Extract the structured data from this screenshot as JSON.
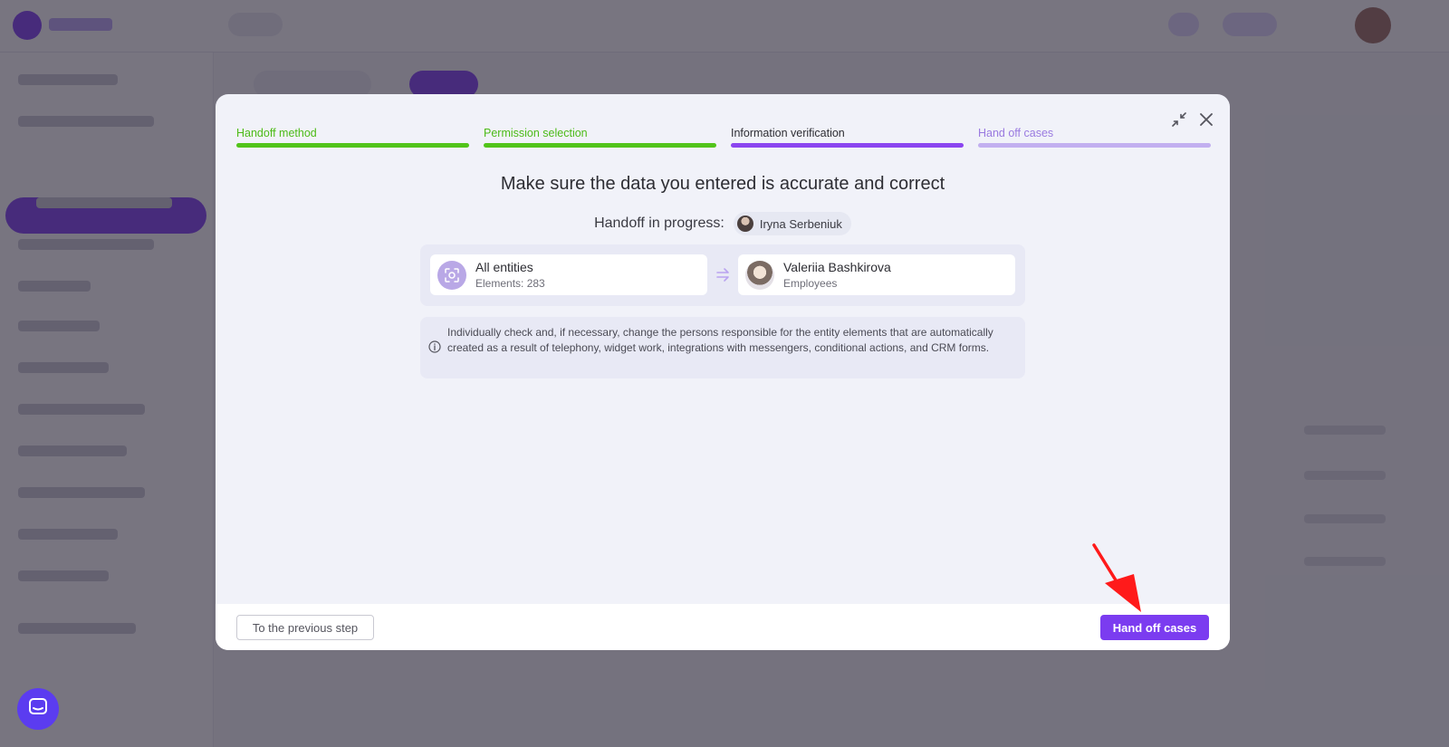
{
  "modal": {
    "steps": [
      {
        "label": "Handoff method",
        "status": "completed",
        "label_color": "#4cbb17",
        "bar_color": "#52c41a"
      },
      {
        "label": "Permission selection",
        "status": "completed",
        "label_color": "#4cbb17",
        "bar_color": "#52c41a"
      },
      {
        "label": "Information verification",
        "status": "current",
        "label_color": "#2d2d33",
        "bar_color": "#8b45f0"
      },
      {
        "label": "Hand off cases",
        "status": "upcoming",
        "label_color": "#9a7ae0",
        "bar_color": "#c2aff0"
      }
    ],
    "headline": "Make sure the data you entered is accurate and correct",
    "handoff": {
      "label": "Handoff in progress:",
      "user_name": "Iryna Serbeniuk"
    },
    "transfer": {
      "from": {
        "title": "All entities",
        "subtitle": "Elements: 283",
        "icon": "scan-icon"
      },
      "arrow_icon": "arrow-right-icon",
      "to": {
        "title": "Valeriia Bashkirova",
        "subtitle": "Employees"
      }
    },
    "info_text": "Individually check and, if necessary, change the persons responsible for the entity elements that are automatically created as a result of telephony, widget work, integrations with messengers, conditional actions, and CRM forms.",
    "buttons": {
      "previous": "To the previous step",
      "primary": "Hand off cases"
    }
  },
  "colors": {
    "accent": "#7b3cf0",
    "success": "#52c41a",
    "annotation_arrow": "#ff1a1a"
  }
}
